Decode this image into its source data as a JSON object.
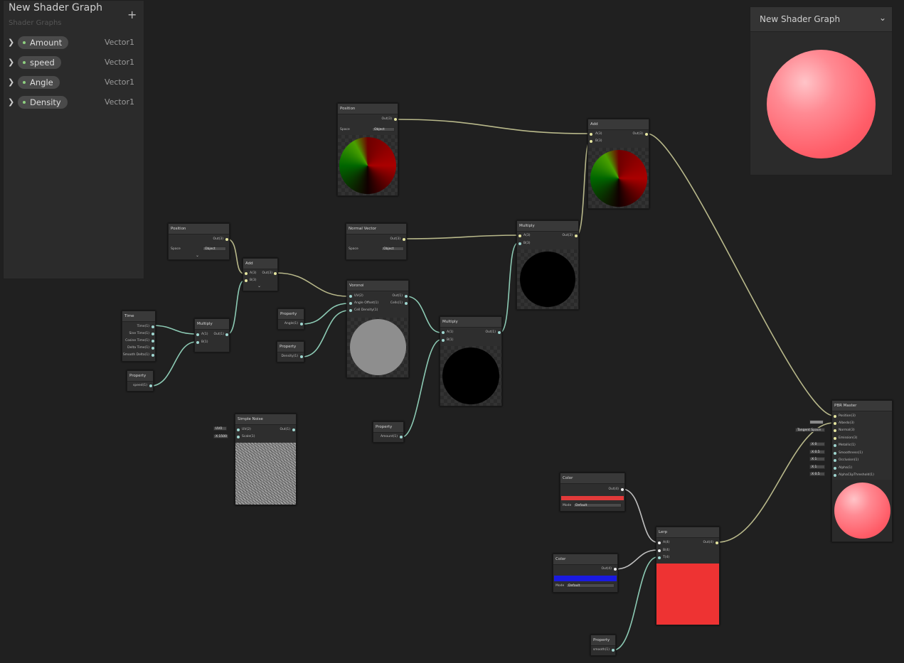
{
  "blackboard": {
    "title": "New Shader Graph",
    "subtitle": "Shader Graphs",
    "add_label": "+",
    "properties": [
      {
        "name": "Amount",
        "type": "Vector1"
      },
      {
        "name": "speed",
        "type": "Vector1"
      },
      {
        "name": "Angle",
        "type": "Vector1"
      },
      {
        "name": "Density",
        "type": "Vector1"
      }
    ]
  },
  "preview": {
    "title": "New Shader Graph",
    "chevron": "⌄"
  },
  "nodes": {
    "position1": {
      "title": "Position",
      "out": "Out(3)",
      "space_label": "Space",
      "space_value": "Object"
    },
    "position2": {
      "title": "Position",
      "out": "Out(3)",
      "space_label": "Space",
      "space_value": "Object"
    },
    "add1": {
      "title": "Add",
      "a": "A(3)",
      "b": "B(3)",
      "out": "Out(3)"
    },
    "add2": {
      "title": "Add",
      "a": "A(3)",
      "b": "B(3)",
      "out": "Out(3)"
    },
    "time": {
      "title": "Time",
      "ports": [
        "Time(1)",
        "Sine Time(1)",
        "Cosine Time(1)",
        "Delta Time(1)",
        "Smooth Delta(1)"
      ]
    },
    "multiply1": {
      "title": "Multiply",
      "a": "A(1)",
      "b": "B(1)",
      "out": "Out(1)"
    },
    "multiply2": {
      "title": "Multiply",
      "a": "A(1)",
      "b": "B(1)",
      "out": "Out(1)"
    },
    "multiply3": {
      "title": "Multiply",
      "a": "A(3)",
      "b": "B(3)",
      "out": "Out(3)"
    },
    "prop_speed": {
      "title": "Property",
      "out": "speed(1)"
    },
    "prop_angle": {
      "title": "Property",
      "out": "Angle(1)"
    },
    "prop_density": {
      "title": "Property",
      "out": "Density(1)"
    },
    "prop_amount": {
      "title": "Property",
      "out": "Amount(1)"
    },
    "prop_smooth": {
      "title": "Property",
      "out": "smooth(1)"
    },
    "normal": {
      "title": "Normal Vector",
      "out": "Out(3)",
      "space_label": "Space",
      "space_value": "Object"
    },
    "voronoi": {
      "title": "Voronoi",
      "ports": [
        "UV(2)",
        "Angle Offset(1)",
        "Cell Density(1)"
      ],
      "outs": [
        "Out(1)",
        "Cells(1)"
      ]
    },
    "noise": {
      "title": "Simple Noise",
      "ports": [
        "UV(2)",
        "Scale(1)"
      ],
      "out": "Out(1)",
      "uv_value": "UV0",
      "scale_value": "X 1500"
    },
    "color1": {
      "title": "Color",
      "out": "Out(4)",
      "mode_label": "Mode",
      "mode_value": "Default",
      "swatch": "#e23a3a"
    },
    "color2": {
      "title": "Color",
      "out": "Out(4)",
      "mode_label": "Mode",
      "mode_value": "Default",
      "swatch": "#1a1ae0"
    },
    "lerp": {
      "title": "Lerp",
      "ports": [
        "A(4)",
        "B(4)",
        "T(4)"
      ],
      "out": "Out(4)",
      "preview_color": "#ee3333"
    },
    "pbr": {
      "title": "PBR Master",
      "ports": [
        "Position(3)",
        "Albedo(3)",
        "Normal(3)",
        "Emission(3)",
        "Metallic(1)",
        "Smoothness(1)",
        "Occlusion(1)",
        "Alpha(1)",
        "AlphaClipThreshold(1)"
      ],
      "inline": [
        "",
        "",
        "Tangent Space",
        "",
        "X 0",
        "X 0.5",
        "X 1",
        "X 1",
        "X 0.5"
      ]
    }
  }
}
